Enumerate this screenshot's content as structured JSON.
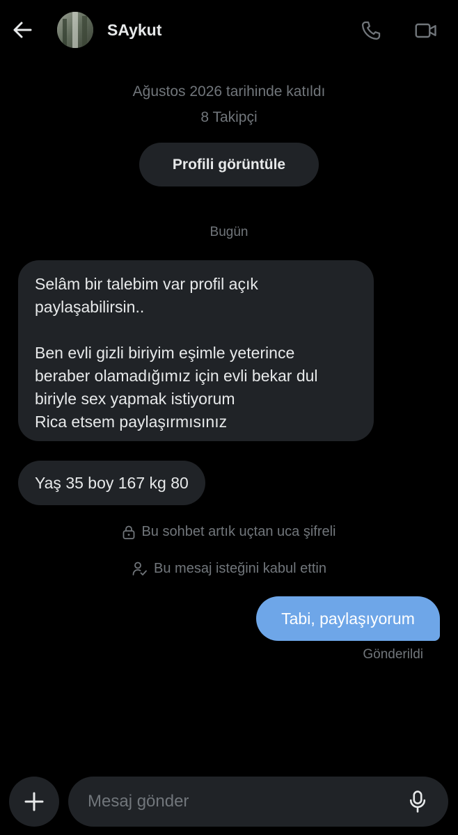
{
  "header": {
    "back_icon": "arrow-left-icon",
    "username": "SAykut",
    "call_icon": "phone-icon",
    "video_icon": "video-camera-icon"
  },
  "profile_info": {
    "joined": "Ağustos 2026 tarihinde katıldı",
    "followers": "8 Takipçi",
    "view_profile_label": "Profili görüntüle"
  },
  "conversation": {
    "date_separator": "Bugün",
    "messages": [
      {
        "direction": "incoming",
        "paragraphs": [
          [
            "Selâm bir talebim var profil açık",
            "paylaşabilirsin.."
          ],
          [
            "Ben evli gizli biriyim eşimle yeterince",
            "beraber olamadığımız için evli bekar dul",
            "biriyle sex yapmak istiyorum",
            "Rica etsem paylaşırmısınız"
          ]
        ]
      },
      {
        "direction": "incoming",
        "text": "Yaş 35 boy 167 kg 80"
      }
    ],
    "system_notices": [
      {
        "icon": "lock-icon",
        "text": "Bu sohbet artık uçtan uca şifreli"
      },
      {
        "icon": "person-check-icon",
        "text": "Bu mesaj isteğini kabul ettin"
      }
    ],
    "outgoing": {
      "text": "Tabi, paylaşıyorum",
      "status": "Gönderildi"
    }
  },
  "composer": {
    "add_icon": "plus-icon",
    "placeholder": "Mesaj gönder",
    "value": "",
    "mic_icon": "microphone-icon"
  },
  "colors": {
    "background": "#000000",
    "incoming_bubble": "#202327",
    "outgoing_bubble": "#6ea6e8",
    "primary_text": "#e7e9ea",
    "secondary_text": "#71767b"
  }
}
